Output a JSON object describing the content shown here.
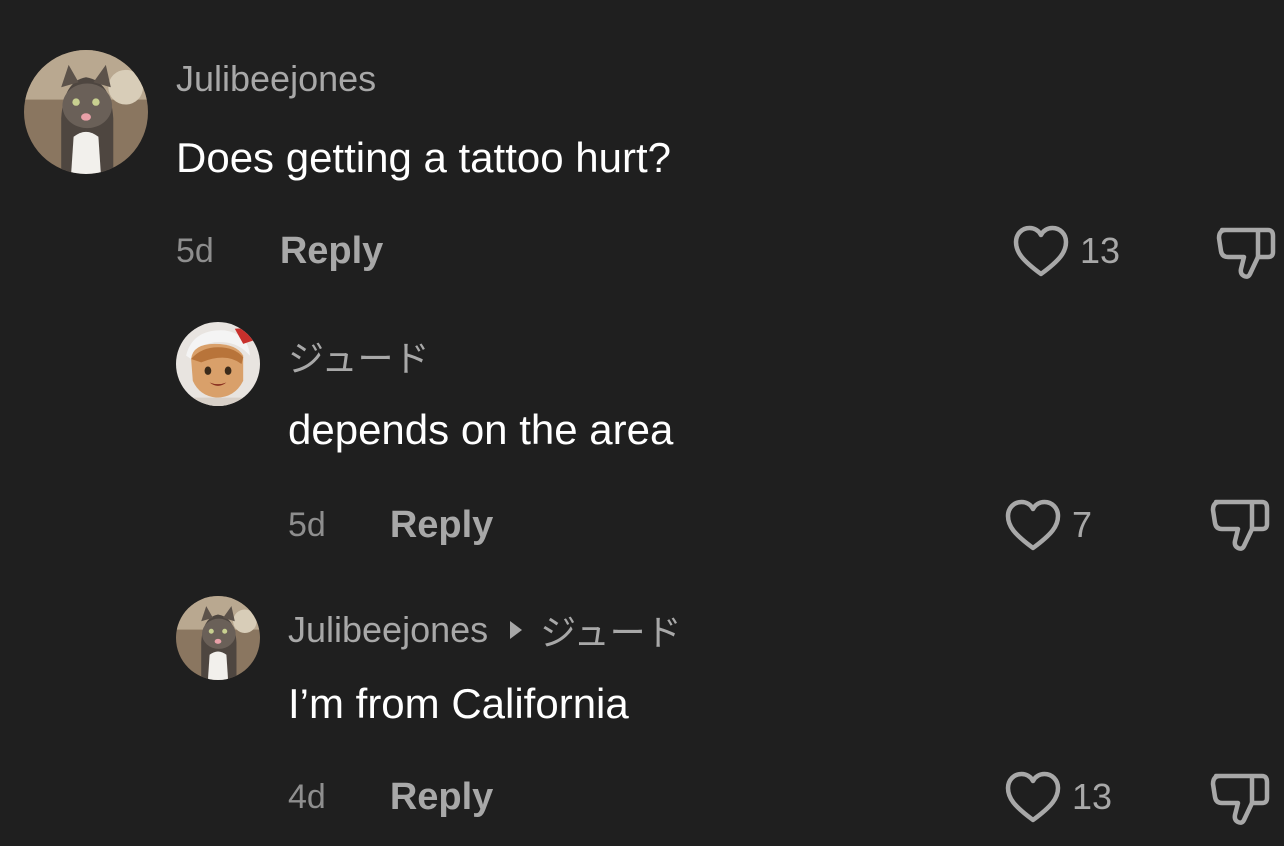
{
  "comments": [
    {
      "username": "Julibeejones",
      "text": "Does getting a tattoo hurt?",
      "age": "5d",
      "reply_label": "Reply",
      "likes": "13",
      "avatar": "cat-avatar"
    },
    {
      "username": "ジュード",
      "text": "depends on the area",
      "age": "5d",
      "reply_label": "Reply",
      "likes": "7",
      "avatar": "anime-avatar"
    },
    {
      "username": "Julibeejones",
      "reply_to": "ジュード",
      "text": "I’m from California",
      "age": "4d",
      "reply_label": "Reply",
      "likes": "13",
      "avatar": "cat-avatar"
    }
  ],
  "colors": {
    "background": "#1f1f1f",
    "text": "#ffffff",
    "secondary": "#a8a8a8"
  },
  "icons": {
    "like": "heart-outline-icon",
    "dislike": "thumbs-down-outline-icon",
    "reply_arrow": "triangle-right-icon"
  }
}
